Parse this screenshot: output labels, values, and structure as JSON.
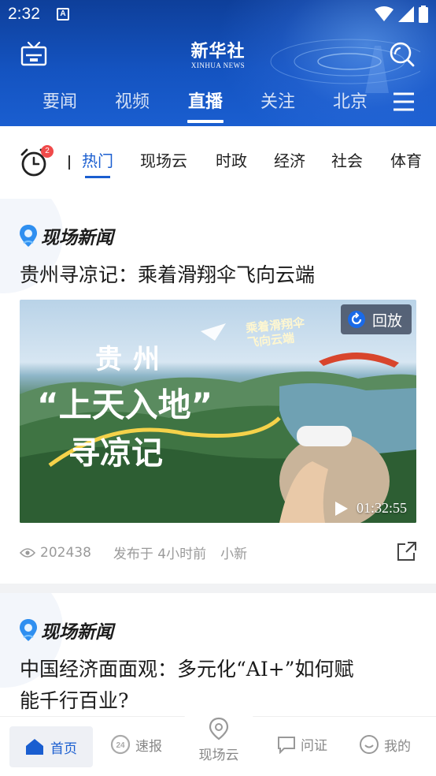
{
  "status_bar": {
    "time": "2:32",
    "notification": "A"
  },
  "header": {
    "logo_cn": "新华社",
    "logo_en": "XINHUA NEWS",
    "tabs": [
      {
        "label": "要闻"
      },
      {
        "label": "视频"
      },
      {
        "label": "直播",
        "active": true
      },
      {
        "label": "关注"
      },
      {
        "label": "北京"
      }
    ]
  },
  "subnav": {
    "badge_count": "2",
    "items": [
      {
        "label": "热门",
        "active": true
      },
      {
        "label": "现场云"
      },
      {
        "label": "时政"
      },
      {
        "label": "经济"
      },
      {
        "label": "社会"
      },
      {
        "label": "体育"
      }
    ]
  },
  "cards": [
    {
      "brand": "现场新闻",
      "title": "贵州寻凉记：乘着滑翔伞飞向云端",
      "video": {
        "overlay_line1": "贵州",
        "overlay_line2": "“上天入地”",
        "overlay_line3": "寻凉记",
        "overlay_tag": "乘着滑翔伞\n飞向云端",
        "replay_label": "回放",
        "duration": "01:32:55"
      },
      "views": "202438",
      "published": "发布于 4小时前",
      "author": "小新"
    },
    {
      "brand": "现场新闻",
      "title_line1": "中国经济面面观：多元化“AI+”如何赋",
      "title_line2": "能千行百业?"
    }
  ],
  "bottom_nav": {
    "home": "首页",
    "flash": "速报",
    "live": "现场云",
    "ask": "问证",
    "mine": "我的"
  },
  "colors": {
    "brand_blue": "#1a5ed0",
    "header_dark": "#0e3f9a",
    "badge_red": "#f04a4a"
  }
}
